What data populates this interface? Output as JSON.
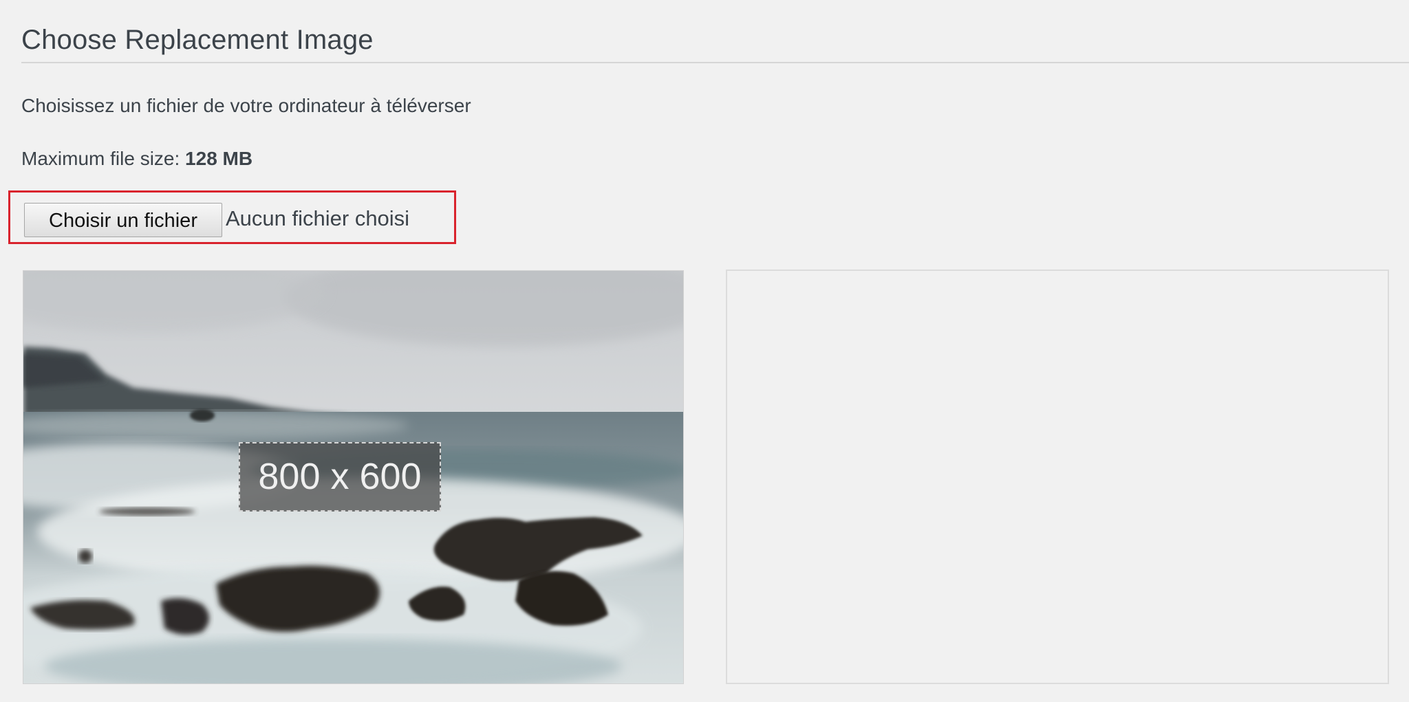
{
  "section": {
    "title": "Choose Replacement Image",
    "description": "Choisissez un fichier de votre ordinateur à téléverser",
    "max_size_label": "Maximum file size: ",
    "max_size_value": "128 MB"
  },
  "file_input": {
    "button_label": "Choisir un fichier",
    "status_text": "Aucun fichier choisi",
    "highlight_color": "#d9232d"
  },
  "preview": {
    "current_image_subject": "blurred rocky coastline with waves",
    "dimension_label": "800 x 600",
    "replacement_preview_empty": true
  }
}
